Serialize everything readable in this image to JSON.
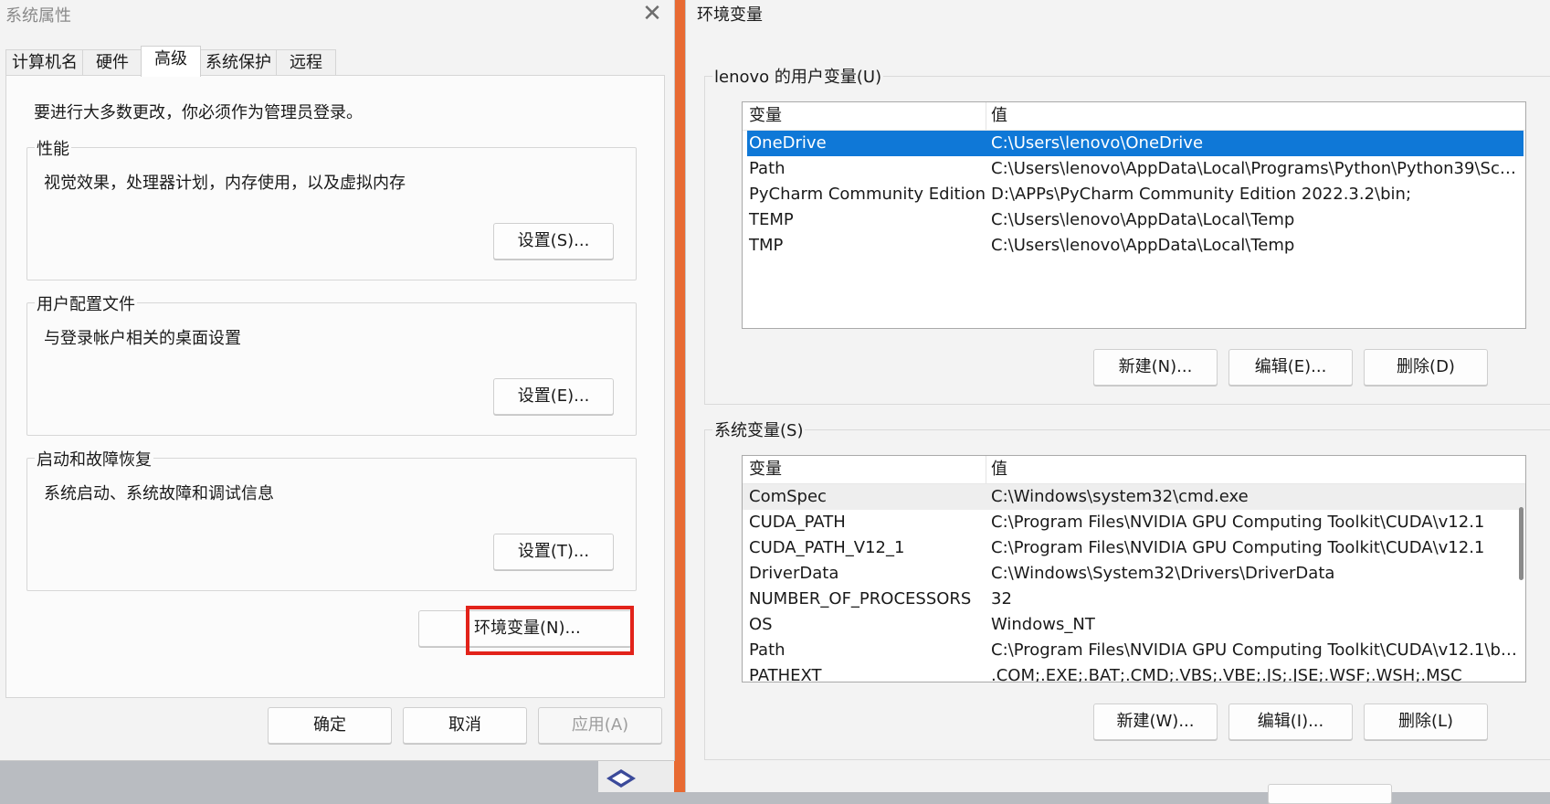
{
  "system_properties": {
    "title": "系统属性",
    "close_glyph": "✕",
    "tabs": [
      "计算机名",
      "硬件",
      "高级",
      "系统保护",
      "远程"
    ],
    "active_tab": "高级",
    "admin_notice": "要进行大多数更改，你必须作为管理员登录。",
    "groups": [
      {
        "title": "性能",
        "description": "视觉效果，处理器计划，内存使用，以及虚拟内存",
        "button": "设置(S)..."
      },
      {
        "title": "用户配置文件",
        "description": "与登录帐户相关的桌面设置",
        "button": "设置(E)..."
      },
      {
        "title": "启动和故障恢复",
        "description": "系统启动、系统故障和调试信息",
        "button": "设置(T)..."
      }
    ],
    "env_button": "环境变量(N)...",
    "highlight_color": "#e2231a",
    "footer": {
      "ok": "确定",
      "cancel": "取消",
      "apply": "应用(A)"
    }
  },
  "environment_variables": {
    "title": "环境变量",
    "user_section": {
      "title": "lenovo 的用户变量(U)",
      "columns": [
        "变量",
        "值"
      ],
      "rows": [
        {
          "name": "OneDrive",
          "value": "C:\\Users\\lenovo\\OneDrive",
          "selected": true
        },
        {
          "name": "Path",
          "value": "C:\\Users\\lenovo\\AppData\\Local\\Programs\\Python\\Python39\\Scrip..."
        },
        {
          "name": "PyCharm Community Edition",
          "value": "D:\\APPs\\PyCharm Community Edition 2022.3.2\\bin;"
        },
        {
          "name": "TEMP",
          "value": "C:\\Users\\lenovo\\AppData\\Local\\Temp"
        },
        {
          "name": "TMP",
          "value": "C:\\Users\\lenovo\\AppData\\Local\\Temp"
        }
      ],
      "buttons": {
        "new": "新建(N)...",
        "edit": "编辑(E)...",
        "delete": "删除(D)"
      }
    },
    "system_section": {
      "title": "系统变量(S)",
      "columns": [
        "变量",
        "值"
      ],
      "rows": [
        {
          "name": "ComSpec",
          "value": "C:\\Windows\\system32\\cmd.exe"
        },
        {
          "name": "CUDA_PATH",
          "value": "C:\\Program Files\\NVIDIA GPU Computing Toolkit\\CUDA\\v12.1"
        },
        {
          "name": "CUDA_PATH_V12_1",
          "value": "C:\\Program Files\\NVIDIA GPU Computing Toolkit\\CUDA\\v12.1"
        },
        {
          "name": "DriverData",
          "value": "C:\\Windows\\System32\\Drivers\\DriverData"
        },
        {
          "name": "NUMBER_OF_PROCESSORS",
          "value": "32"
        },
        {
          "name": "OS",
          "value": "Windows_NT"
        },
        {
          "name": "Path",
          "value": "C:\\Program Files\\NVIDIA GPU Computing Toolkit\\CUDA\\v12.1\\bin..."
        },
        {
          "name": "PATHEXT",
          "value": ".COM;.EXE;.BAT;.CMD;.VBS;.VBE;.JS;.JSE;.WSF;.WSH;.MSC"
        }
      ],
      "buttons": {
        "new": "新建(W)...",
        "edit": "编辑(I)...",
        "delete": "删除(L)"
      }
    },
    "accent_color": "#0f78d7"
  }
}
